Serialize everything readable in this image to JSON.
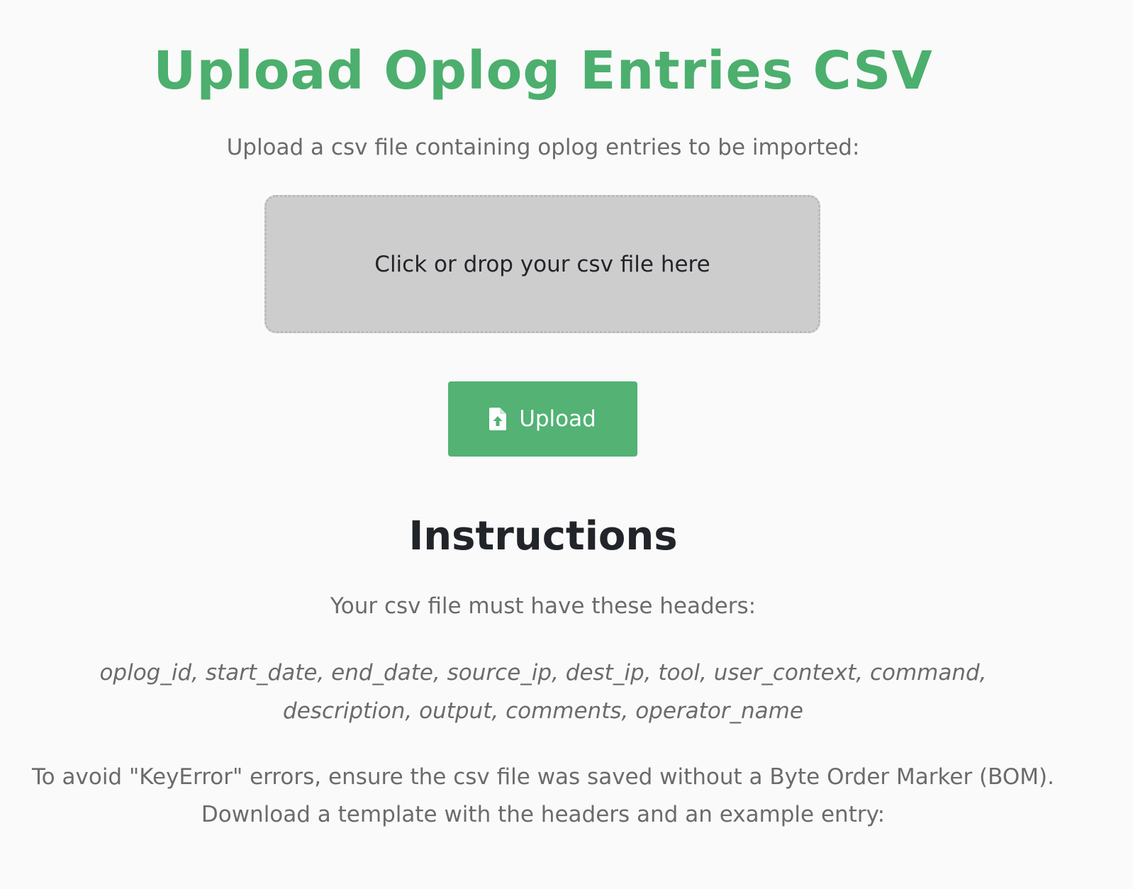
{
  "page": {
    "title": "Upload Oplog Entries CSV",
    "subtitle": "Upload a csv file containing oplog entries to be imported:"
  },
  "dropzone": {
    "label": "Click or drop your csv file here"
  },
  "upload_button": {
    "label": "Upload",
    "icon": "file-upload-icon"
  },
  "instructions": {
    "heading": "Instructions",
    "headers_intro": "Your csv file must have these headers:",
    "headers_line1": "oplog_id, start_date, end_date, source_ip, dest_ip, tool, user_context, command,",
    "headers_line2": "description, output, comments, operator_name",
    "bom_line1": "To avoid \"KeyError\" errors, ensure the csv file was saved without a Byte Order Marker (BOM).",
    "bom_line2": "Download a template with the headers and an example entry:"
  },
  "colors": {
    "accent": "#4caf6e",
    "button": "#53b274",
    "dropzone_bg": "#cdcdcd",
    "page_bg": "#fafafa"
  }
}
